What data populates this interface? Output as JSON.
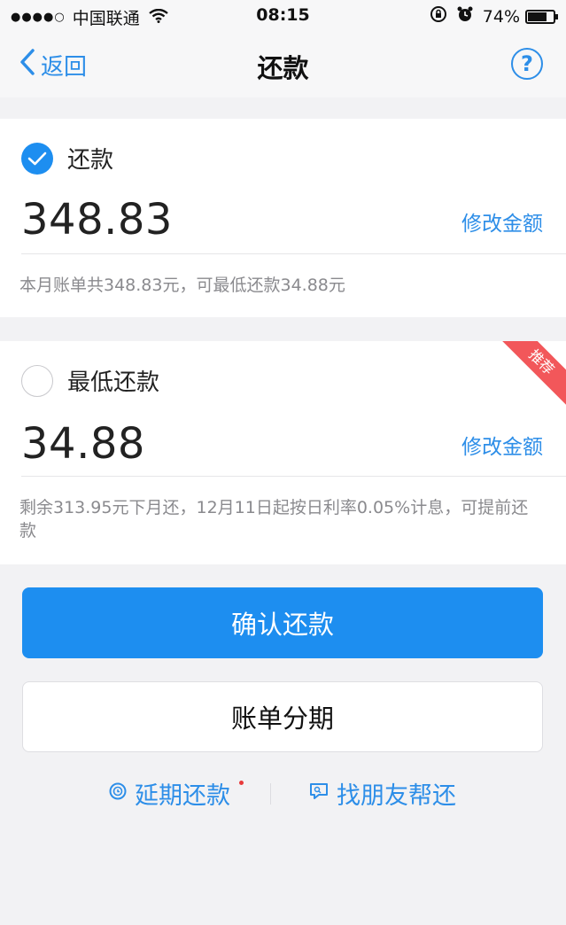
{
  "status_bar": {
    "signal_dots": "●●●●○",
    "carrier": "中国联通",
    "time": "08:15",
    "battery": "74%",
    "battery_level": 0.74
  },
  "nav": {
    "back_label": "返回",
    "title": "还款",
    "help_label": "?"
  },
  "options": [
    {
      "label": "还款",
      "checked": true,
      "amount": "348.83",
      "edit_label": "修改金额",
      "note": "本月账单共348.83元，可最低还款34.88元"
    },
    {
      "label": "最低还款",
      "checked": false,
      "amount": "34.88",
      "edit_label": "修改金额",
      "note": "剩余313.95元下月还，12月11日起按日利率0.05%计息，可提前还款",
      "ribbon": "推荐"
    }
  ],
  "buttons": {
    "confirm": "确认还款",
    "installment": "账单分期"
  },
  "links": {
    "delay": "延期还款",
    "friend": "找朋友帮还"
  },
  "colors": {
    "accent": "#1d8ef0",
    "link": "#2d8ee8",
    "ribbon": "#f2575a"
  }
}
